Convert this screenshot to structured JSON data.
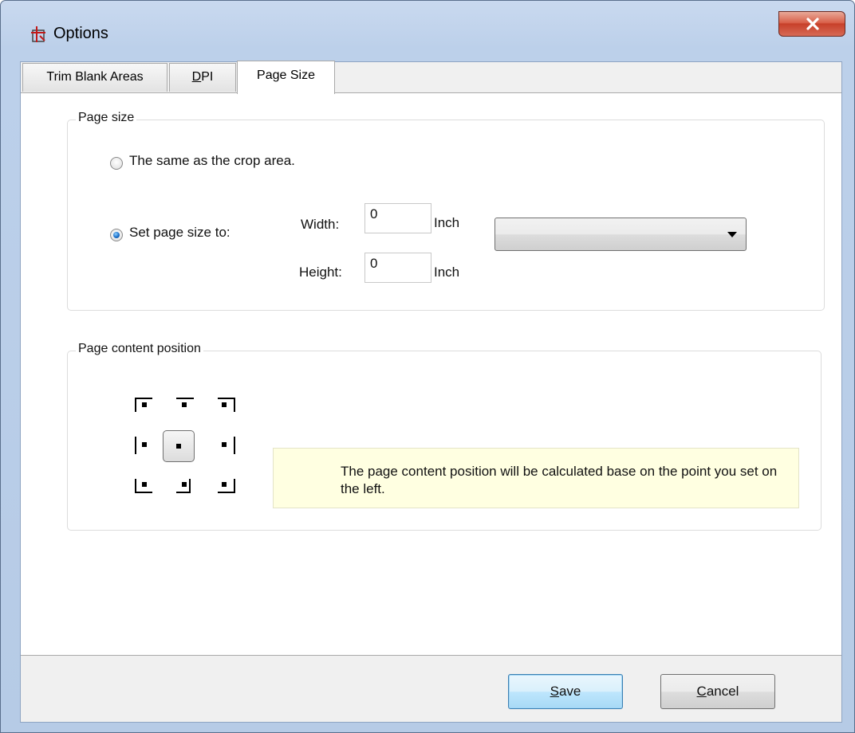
{
  "window": {
    "title": "Options"
  },
  "tabs": [
    {
      "label": "Trim Blank Areas",
      "prefix": "",
      "mnemonic": "",
      "suffix": ""
    },
    {
      "label": "",
      "prefix": "",
      "mnemonic": "D",
      "suffix": "PI"
    },
    {
      "label": "Page Size",
      "prefix": "",
      "mnemonic": "",
      "suffix": ""
    }
  ],
  "active_tab": "Page Size",
  "page_size": {
    "legend": "Page size",
    "option_same": {
      "label": "The same as the crop area.",
      "checked": false
    },
    "option_set": {
      "label": "Set page size to:",
      "checked": true
    },
    "width": {
      "label": "Width:",
      "value": "0",
      "unit": "Inch"
    },
    "height": {
      "label": "Height:",
      "value": "0",
      "unit": "Inch"
    },
    "preset": {
      "selected": ""
    }
  },
  "content_position": {
    "legend": "Page content position",
    "selected": "center",
    "note": "The page content position will be calculated base on the point you set on the left."
  },
  "buttons": {
    "save": {
      "mnemonic": "S",
      "rest": "ave"
    },
    "cancel": {
      "mnemonic": "C",
      "rest": "ancel"
    }
  }
}
